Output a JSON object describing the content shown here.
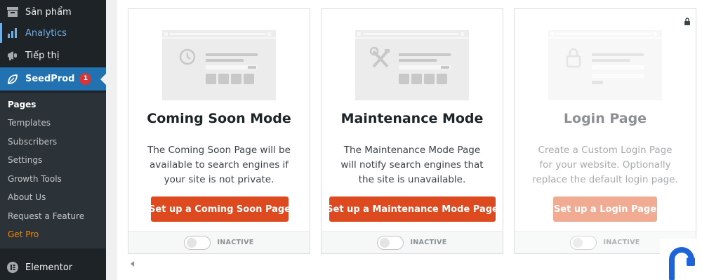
{
  "sidebar": {
    "items": [
      {
        "label": "Sản phẩm",
        "icon": "archive-icon"
      },
      {
        "label": "Analytics",
        "icon": "bar-chart-icon"
      },
      {
        "label": "Tiếp thị",
        "icon": "megaphone-icon"
      },
      {
        "label": "SeedProd",
        "icon": "seedprod-leaf-icon",
        "badge": "1"
      },
      {
        "label": "Elementor",
        "icon": "elementor-icon"
      }
    ],
    "submenu": [
      {
        "label": "Pages"
      },
      {
        "label": "Templates"
      },
      {
        "label": "Subscribers"
      },
      {
        "label": "Settings"
      },
      {
        "label": "Growth Tools"
      },
      {
        "label": "About Us"
      },
      {
        "label": "Request a Feature"
      },
      {
        "label": "Get Pro"
      }
    ]
  },
  "cards": [
    {
      "title": "Coming Soon Mode",
      "description": "The Coming Soon Page will be available to search engines if your site is not private.",
      "button": "Set up a Coming Soon Page",
      "status": "INACTIVE",
      "icon": "clock-icon"
    },
    {
      "title": "Maintenance Mode",
      "description": "The Maintenance Mode Page will notify search engines that the site is unavailable.",
      "button": "Set up a Maintenance Mode Page",
      "status": "INACTIVE",
      "icon": "tools-icon"
    },
    {
      "title": "Login Page",
      "description": "Create a Custom Login Page for your website. Optionally replace the default login page.",
      "button": "Set up a Login Page",
      "status": "INACTIVE",
      "icon": "lock-icon",
      "locked": true
    }
  ],
  "colors": {
    "sidebar_bg": "#1d2327",
    "active_menu": "#2271b1",
    "button": "#dd4a1f",
    "get_pro": "#f18500",
    "badge": "#d63638"
  }
}
